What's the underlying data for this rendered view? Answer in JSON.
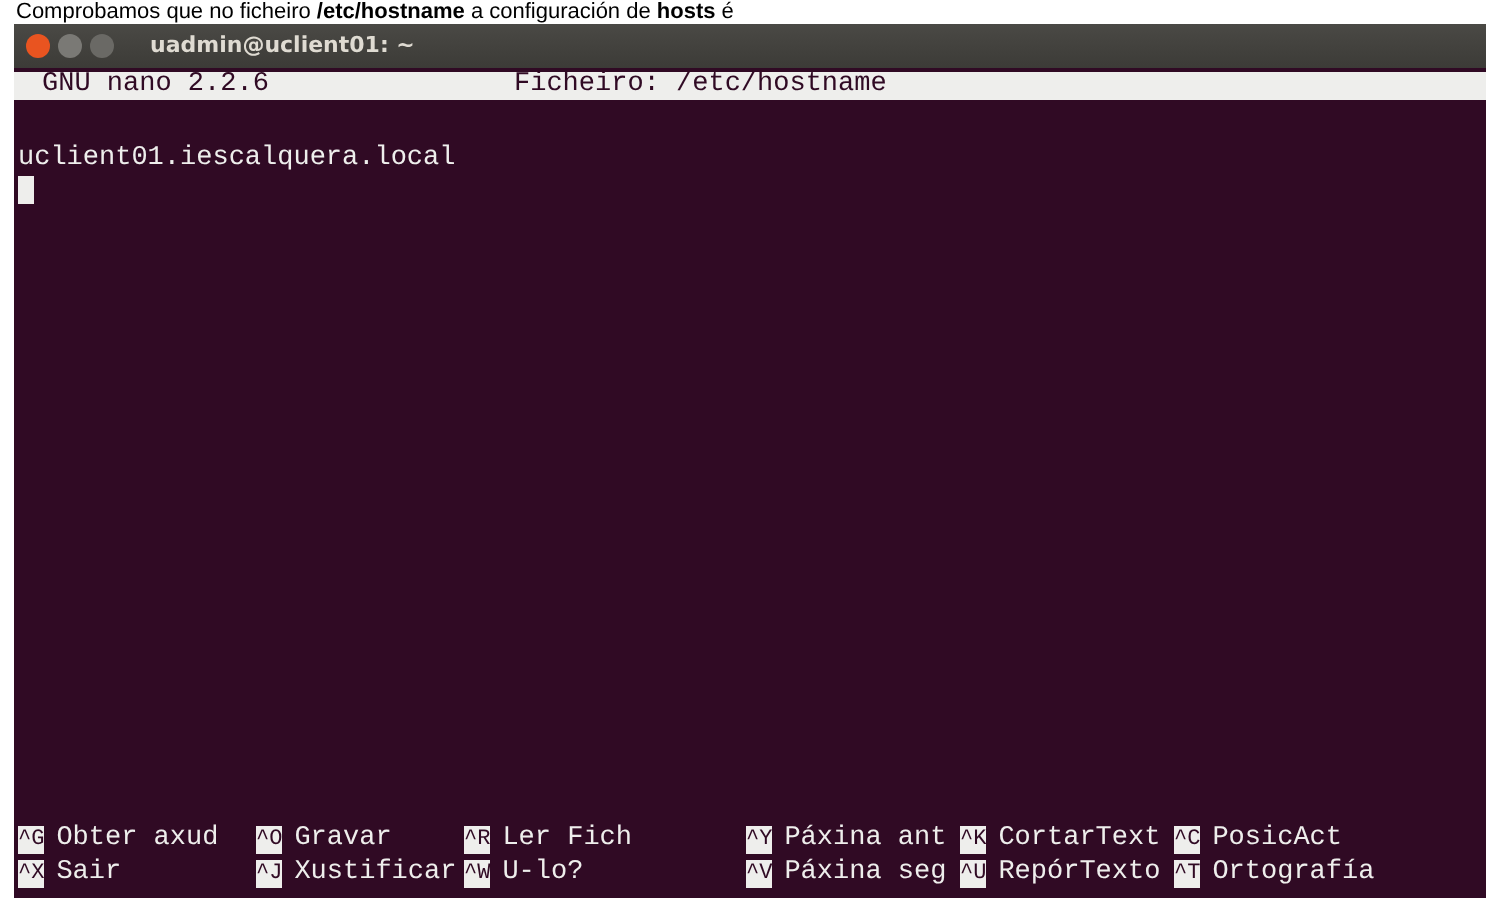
{
  "caption": {
    "text": "Comprobamos que no ficheiro **/etc/hostname** a configuración de **hosts** é"
  },
  "window": {
    "title": "uadmin@uclient01: ~"
  },
  "nano_header": {
    "version": "GNU nano 2.2.6",
    "file": "Ficheiro: /etc/hostname"
  },
  "editor": {
    "lines": [
      "uclient01.iescalquera.local"
    ]
  },
  "shortcuts": [
    [
      {
        "key": "^G",
        "label": "Obter axud"
      },
      {
        "key": "^O",
        "label": "Gravar"
      },
      {
        "key": "^R",
        "label": "Ler Fich"
      },
      {
        "key": "^Y",
        "label": "Páxina ant"
      },
      {
        "key": "^K",
        "label": "CortarText"
      },
      {
        "key": "^C",
        "label": "PosicAct"
      }
    ],
    [
      {
        "key": "^X",
        "label": "Sair"
      },
      {
        "key": "^J",
        "label": "Xustificar"
      },
      {
        "key": "^W",
        "label": "U-lo?"
      },
      {
        "key": "^V",
        "label": "Páxina seg"
      },
      {
        "key": "^U",
        "label": "RepórTexto"
      },
      {
        "key": "^T",
        "label": "Ortografía"
      }
    ]
  ]
}
